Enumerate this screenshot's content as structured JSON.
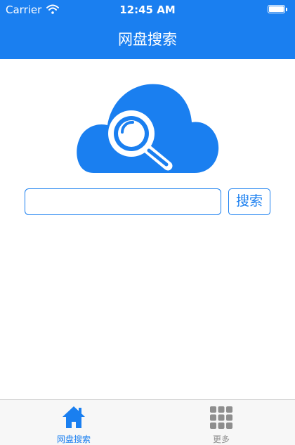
{
  "status_bar": {
    "carrier": "Carrier",
    "time": "12:45 AM",
    "battery_level": 1.0
  },
  "nav": {
    "title": "网盘搜索"
  },
  "logo": {
    "icon": "cloud-search-icon"
  },
  "search": {
    "value": "",
    "placeholder": "",
    "button_label": "搜索"
  },
  "tabbar": {
    "tabs": [
      {
        "label": "网盘搜索",
        "icon": "home-icon",
        "selected": true
      },
      {
        "label": "更多",
        "icon": "grid-icon",
        "selected": false
      }
    ]
  },
  "colors": {
    "accent": "#1a7ff0",
    "tab_inactive": "#8e8e8e",
    "tabbar_bg": "#f7f7f7"
  }
}
